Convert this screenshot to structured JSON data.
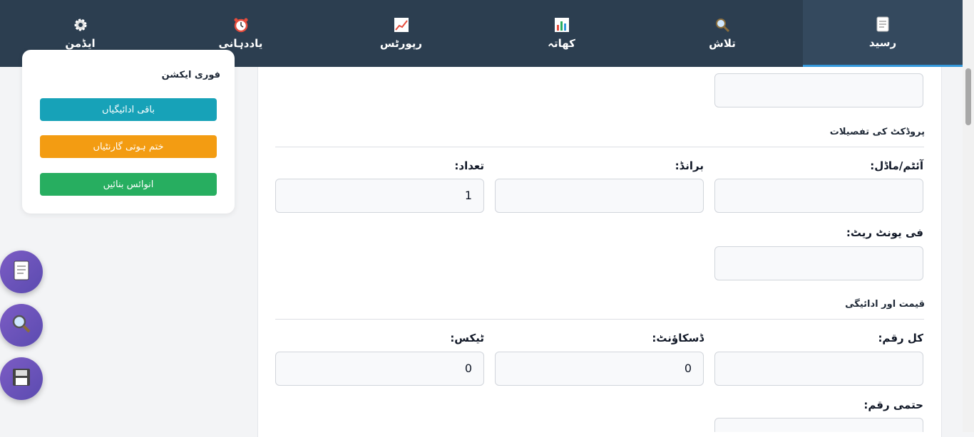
{
  "nav": {
    "items": [
      {
        "label": "رسید",
        "icon": "receipt-icon"
      },
      {
        "label": "تلاش",
        "icon": "search-icon"
      },
      {
        "label": "کھاتہ",
        "icon": "bar-chart-icon"
      },
      {
        "label": "رپورٹس",
        "icon": "line-chart-icon"
      },
      {
        "label": "یاددہانی",
        "icon": "alarm-clock-icon"
      },
      {
        "label": "ایڈمن",
        "icon": "gear-icon"
      }
    ],
    "active": "رسید"
  },
  "quick_actions": {
    "title": "فوری ایکشن",
    "buttons": [
      {
        "label": "باقی ادائیگیاں",
        "color": "#17a2b8"
      },
      {
        "label": "ختم ہوتی گارنٹیاں",
        "color": "#f39c12"
      },
      {
        "label": "انوائس بنائیں",
        "color": "#27ae60"
      }
    ]
  },
  "fabs": [
    {
      "icon": "document-icon"
    },
    {
      "icon": "search-icon"
    },
    {
      "icon": "save-icon"
    }
  ],
  "form": {
    "product_section": "پروڈکٹ کی تفصیلات",
    "item_model_label": "آئٹم/ماڈل:",
    "brand_label": "برانڈ:",
    "quantity_label": "تعداد:",
    "quantity_value": "1",
    "unit_rate_label": "فی یونٹ ریٹ:",
    "price_section": "قیمت اور ادائیگی",
    "total_label": "کل رقم:",
    "discount_label": "ڈسکاؤنٹ:",
    "discount_value": "0",
    "tax_label": "ٹیکس:",
    "tax_value": "0",
    "final_label": "حتمی رقم:"
  },
  "colors": {
    "nav_bg": "#2c3e50",
    "nav_active": "#34495e",
    "accent": "#3498db",
    "fab": "#6c52bd"
  }
}
